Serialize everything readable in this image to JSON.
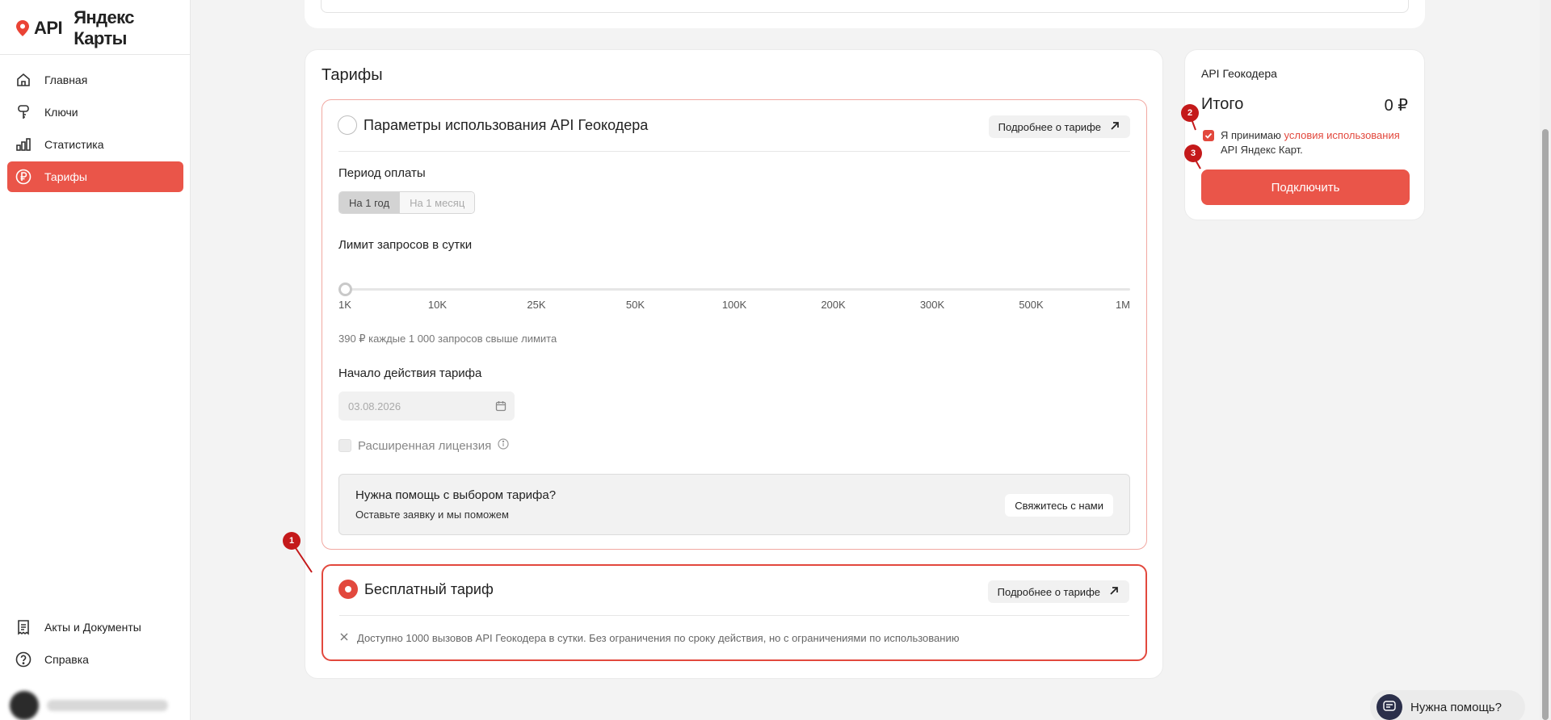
{
  "logo": {
    "api": "API",
    "name": "Яндекс Карты",
    "accent": "#ea4335"
  },
  "sidebar": {
    "items": [
      {
        "label": "Главная",
        "icon": "home-icon"
      },
      {
        "label": "Ключи",
        "icon": "key-icon"
      },
      {
        "label": "Статистика",
        "icon": "stats-icon"
      },
      {
        "label": "Тарифы",
        "icon": "ruble-icon",
        "active": true
      }
    ],
    "bottom_items": [
      {
        "label": "Акты и Документы",
        "icon": "documents-icon"
      },
      {
        "label": "Справка",
        "icon": "help-icon"
      }
    ]
  },
  "main": {
    "title": "Тарифы",
    "paid_plan": {
      "name": "Параметры использования API Геокодера",
      "more_label": "Подробнее о тарифе",
      "period_label": "Период оплаты",
      "period_options": [
        "На 1 год",
        "На 1 месяц"
      ],
      "period_selected": "На 1 год",
      "limit_label": "Лимит запросов в сутки",
      "limit_ticks": [
        "1K",
        "10K",
        "25K",
        "50K",
        "100K",
        "200K",
        "300K",
        "500K",
        "1M"
      ],
      "limit_value": "1K",
      "overage_hint": "390 ₽ каждые 1 000 запросов свыше лимита",
      "start_label": "Начало действия тарифа",
      "start_value": "03.08.2026",
      "license_label": "Расширенная лицензия",
      "help_title": "Нужна помощь с выбором тарифа?",
      "help_sub": "Оставьте заявку и мы поможем",
      "contact_label": "Свяжитесь с нами"
    },
    "free_plan": {
      "name": "Бесплатный тариф",
      "more_label": "Подробнее о тарифе",
      "description": "Доступно 1000 вызовов API Геокодера в сутки. Без ограничения по сроку действия, но с ограничениями по использованию",
      "selected": true
    }
  },
  "summary": {
    "title": "API Геокодера",
    "total_label": "Итого",
    "total_value": "0 ₽",
    "accept_prefix": "Я принимаю ",
    "accept_link": "условия использования",
    "accept_suffix": " API Яндекс Карт.",
    "accepted": true,
    "connect_label": "Подключить"
  },
  "markers": [
    "1",
    "2",
    "3"
  ],
  "help_widget": {
    "label": "Нужна помощь?"
  },
  "colors": {
    "accent": "#ea5549",
    "danger": "#e2483d",
    "marker": "#c4191a"
  }
}
